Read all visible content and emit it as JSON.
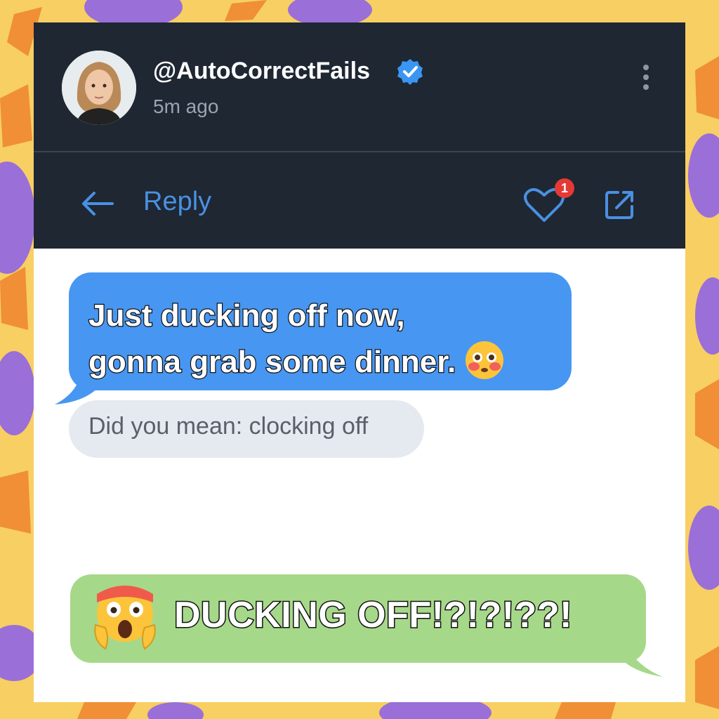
{
  "post": {
    "username": "@AutoCorrectFails",
    "timestamp": "5m ago",
    "verified": true
  },
  "actions": {
    "reply_label": "Reply",
    "like_badge_count": "1"
  },
  "messages": {
    "incoming_line1": "Just ducking off now,",
    "incoming_line2": "gonna grab some dinner.",
    "suggestion": "Did you mean: clocking off",
    "outgoing": "DUCKING OFF!?!?!??!"
  },
  "icons": {
    "avatar": "avatar-photo",
    "verified": "verified-badge-icon",
    "more": "more-vertical-icon",
    "back": "arrow-left-icon",
    "like": "heart-icon",
    "share": "share-icon",
    "emoji_incoming": "flushed-face-emoji",
    "emoji_outgoing": "screaming-face-emoji"
  },
  "colors": {
    "header_bg": "#1e2732",
    "accent_blue": "#4a90e2",
    "incoming_bubble": "#4796f2",
    "outgoing_bubble": "#a6d889",
    "badge_red": "#e53935",
    "background_yellow": "#f7cf63"
  }
}
